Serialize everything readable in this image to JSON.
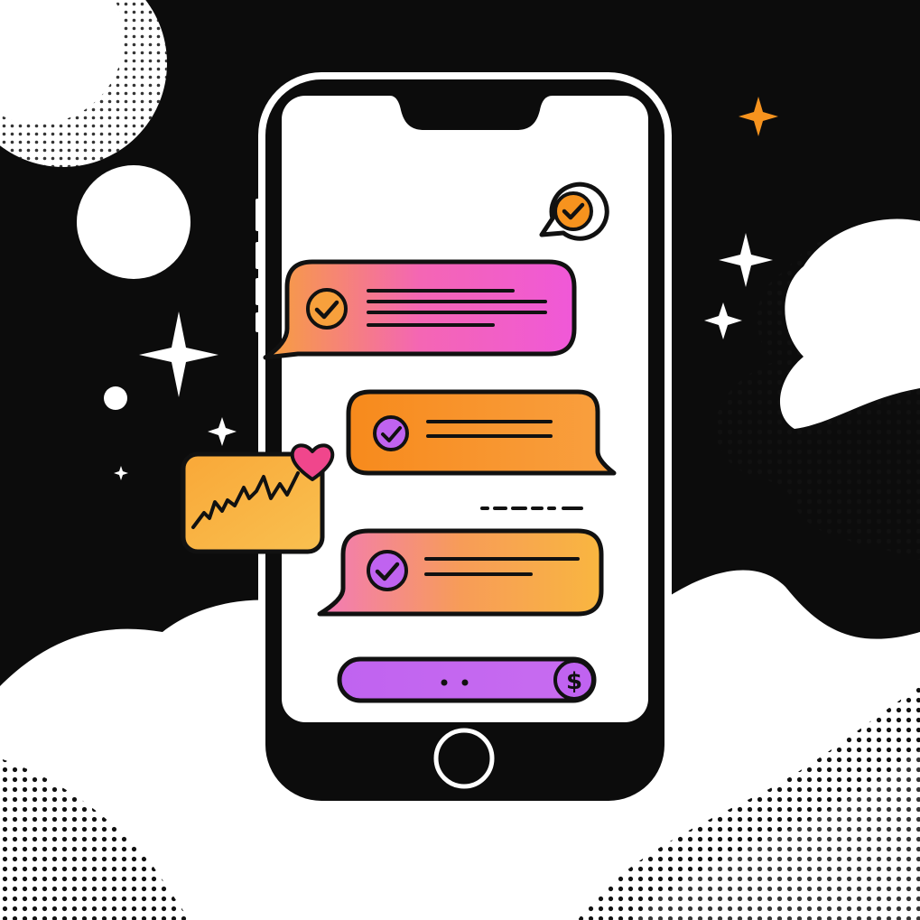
{
  "palette": {
    "background": "#0c0c0c",
    "outline": "#111111",
    "white": "#ffffff",
    "pink": "#f05ad2",
    "orange": "#f7931e",
    "amber": "#f9b640",
    "purple": "#c063f0",
    "heart": "#f0468c"
  },
  "icons": {
    "notification": "check-circle-icon",
    "message_check": "check-circle-icon",
    "chart_card": "trend-line-icon",
    "heart": "heart-icon",
    "currency": "dollar-icon",
    "home": "home-button",
    "sparkle": "sparkle-icon"
  },
  "action_bar": {
    "currency_symbol": "$"
  }
}
